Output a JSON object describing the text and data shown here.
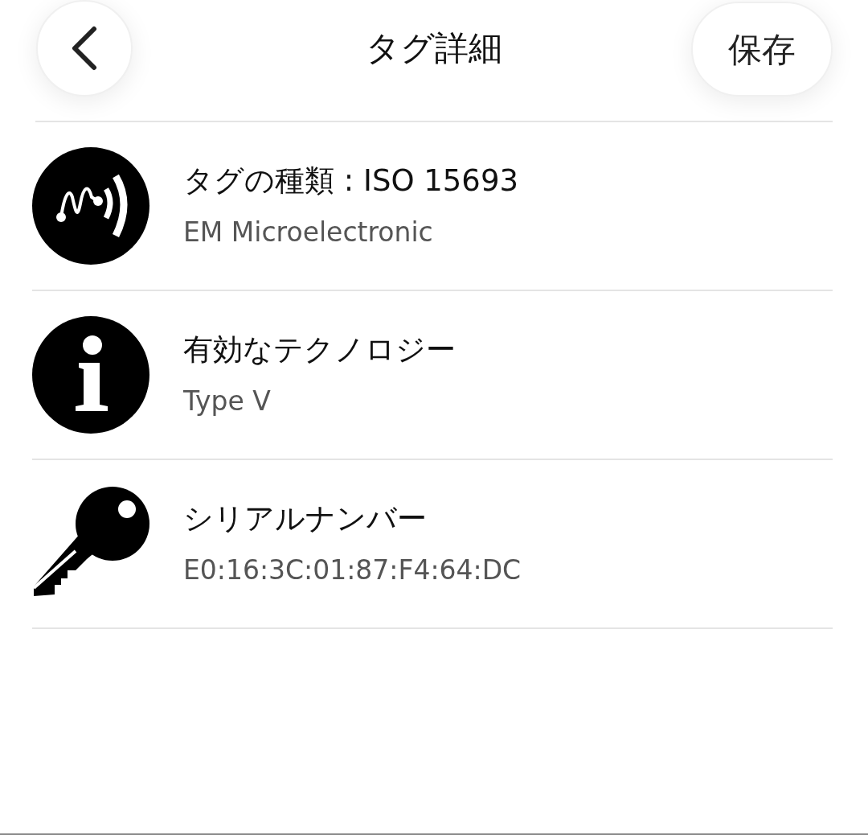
{
  "header": {
    "title": "タグ詳細",
    "save": "保存"
  },
  "rows": [
    {
      "kind": "nfc",
      "title": "タグの種類 : ISO 15693",
      "subtitle": "EM Microelectronic"
    },
    {
      "kind": "info",
      "title": "有効なテクノロジー",
      "subtitle": "Type V"
    },
    {
      "kind": "key",
      "title": "シリアルナンバー",
      "subtitle": "E0:16:3C:01:87:F4:64:DC"
    }
  ]
}
